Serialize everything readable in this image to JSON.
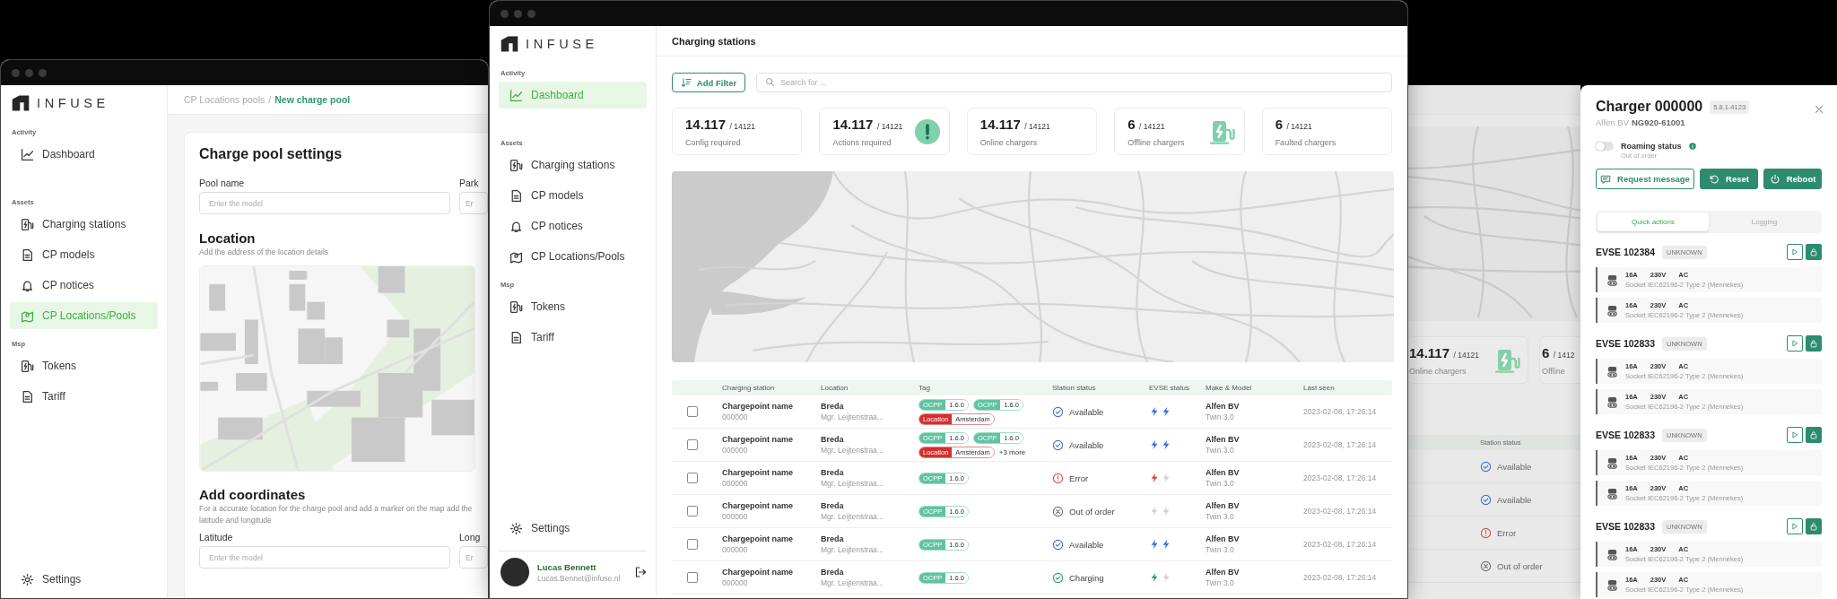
{
  "left_window": {
    "logo": "INFUSE",
    "sidebar": {
      "sections": [
        {
          "heading": "Activity",
          "items": [
            {
              "label": "Dashboard",
              "selected": false
            }
          ]
        },
        {
          "heading": "Assets",
          "items": [
            {
              "label": "Charging stations",
              "selected": false
            },
            {
              "label": "CP models",
              "selected": false
            },
            {
              "label": "CP notices",
              "selected": false
            },
            {
              "label": "CP Locations/Pools",
              "selected": true
            }
          ]
        },
        {
          "heading": "Msp",
          "items": [
            {
              "label": "Tokens",
              "selected": false
            },
            {
              "label": "Tariff",
              "selected": false
            }
          ]
        }
      ],
      "settings": "Settings"
    },
    "breadcrumb": {
      "items": [
        {
          "label": "CP Locations pools",
          "selected": false
        },
        {
          "label": "New charge pool",
          "selected": true
        }
      ],
      "separator": "/"
    },
    "form": {
      "title": "Charge pool settings",
      "name_fields": [
        {
          "label": "Pool name",
          "placeholder": "Enter the model"
        },
        {
          "label": "Park",
          "placeholder": "Er"
        }
      ],
      "location": {
        "title": "Location",
        "subtitle": "Add the address of the location details"
      },
      "coordinates": {
        "title": "Add coordinates",
        "subtitle": "For a accurate location for the charge pool and add a marker on the map add the latitude and longitude",
        "fields": [
          {
            "label": "Latitude",
            "placeholder": "Enter the model"
          },
          {
            "label": "Long",
            "placeholder": "Er"
          }
        ]
      }
    }
  },
  "center_window": {
    "logo": "INFUSE",
    "sidebar": {
      "sections": [
        {
          "heading": "Activity",
          "items": [
            {
              "label": "Dashboard",
              "selected": true
            }
          ]
        },
        {
          "heading": "Assets",
          "items": [
            {
              "label": "Charging stations",
              "selected": false
            },
            {
              "label": "CP models",
              "selected": false
            },
            {
              "label": "CP notices",
              "selected": false
            },
            {
              "label": "CP Locations/Pools",
              "selected": false
            }
          ]
        },
        {
          "heading": "Msp",
          "items": [
            {
              "label": "Tokens",
              "selected": false
            },
            {
              "label": "Tariff",
              "selected": false
            }
          ]
        }
      ],
      "settings": "Settings"
    },
    "user": {
      "name": "Lucas Bennett",
      "email": "Lucas.Bennet@infuse.nl"
    },
    "title": "Charging stations",
    "filter_button": "Add Filter",
    "search": {
      "placeholder": "Search for ..."
    },
    "stats": [
      {
        "value": "14.117",
        "total": "/ 14121",
        "label": "Config required"
      },
      {
        "value": "14.117",
        "total": "/ 14121",
        "label": "Actions required"
      },
      {
        "value": "14.117",
        "total": "/ 14121",
        "label": "Online chargers"
      },
      {
        "value": "6",
        "total": "/ 14121",
        "label": "Offline chargers"
      },
      {
        "value": "6",
        "total": "/ 14121",
        "label": "Faulted chargers"
      }
    ],
    "table": {
      "columns": [
        "Charging station",
        "Location",
        "Tag",
        "Station status",
        "EVSE status",
        "Make & Model",
        "Last seen"
      ],
      "rows": [
        {
          "checked": false,
          "name": "Chargepoint name",
          "id": "000000",
          "city": "Breda",
          "street": "Mgr. Leijtenstraa...",
          "tags": [
            {
              "kind": "ocpp",
              "key": "OCPP",
              "value": "1.6.0"
            },
            {
              "kind": "ocpp",
              "key": "OCPP",
              "value": "1.6.0"
            },
            {
              "kind": "location",
              "key": "Location",
              "value": "Amsterdam"
            }
          ],
          "status": {
            "kind": "available",
            "label": "Available"
          },
          "evse": [
            {
              "kind": "available"
            },
            {
              "kind": "available"
            }
          ],
          "make": "Alfen BV",
          "model": "Twin 3.0",
          "last_seen": "2023-02-08, 17:26:14"
        },
        {
          "checked": false,
          "name": "Chargepoint name",
          "id": "000000",
          "city": "Breda",
          "street": "Mgr. Leijtenstraa...",
          "tags": [
            {
              "kind": "ocpp",
              "key": "OCPP",
              "value": "1.6.0"
            },
            {
              "kind": "ocpp",
              "key": "OCPP",
              "value": "1.6.0"
            },
            {
              "kind": "location",
              "key": "Location",
              "value": "Amsterdam"
            }
          ],
          "more": "+3 more",
          "status": {
            "kind": "available",
            "label": "Available"
          },
          "evse": [
            {
              "kind": "available"
            },
            {
              "kind": "available"
            }
          ],
          "make": "Alfen BV",
          "model": "Twin 3.0",
          "last_seen": "2023-02-08, 17:26:14"
        },
        {
          "checked": false,
          "name": "Chargepoint name",
          "id": "000000",
          "city": "Breda",
          "street": "Mgr. Leijtenstraa...",
          "tags": [
            {
              "kind": "ocpp",
              "key": "OCPP",
              "value": "1.6.0"
            }
          ],
          "status": {
            "kind": "error",
            "label": "Error"
          },
          "evse": [
            {
              "kind": "fault"
            },
            {
              "kind": "off"
            }
          ],
          "make": "Alfen BV",
          "model": "Twin 3.0",
          "last_seen": "2023-02-08, 17:26:14"
        },
        {
          "checked": false,
          "name": "Chargepoint name",
          "id": "000000",
          "city": "Breda",
          "street": "Mgr. Leijtenstraa...",
          "tags": [
            {
              "kind": "ocpp",
              "key": "OCPP",
              "value": "1.6.0"
            }
          ],
          "status": {
            "kind": "out_of_order",
            "label": "Out of order"
          },
          "evse": [
            {
              "kind": "off"
            },
            {
              "kind": "off"
            }
          ],
          "make": "Alfen BV",
          "model": "Twin 3.0",
          "last_seen": "2023-02-08, 17:26:14"
        },
        {
          "checked": false,
          "name": "Chargepoint name",
          "id": "000000",
          "city": "Breda",
          "street": "Mgr. Leijtenstraa...",
          "tags": [
            {
              "kind": "ocpp",
              "key": "OCPP",
              "value": "1.6.0"
            }
          ],
          "status": {
            "kind": "available",
            "label": "Available"
          },
          "evse": [
            {
              "kind": "available"
            },
            {
              "kind": "available"
            }
          ],
          "make": "Alfen BV",
          "model": "Twin 3.0",
          "last_seen": "2023-02-08, 17:26:14"
        },
        {
          "checked": false,
          "name": "Chargepoint name",
          "id": "000000",
          "city": "Breda",
          "street": "Mgr. Leijtenstraa...",
          "tags": [
            {
              "kind": "ocpp",
              "key": "OCPP",
              "value": "1.6.0"
            }
          ],
          "status": {
            "kind": "charging",
            "label": "Charging"
          },
          "evse": [
            {
              "kind": "charging"
            },
            {
              "kind": "off"
            }
          ],
          "make": "Alfen BV",
          "model": "Twin 3.0",
          "last_seen": "2023-02-08, 17:26:14"
        }
      ]
    }
  },
  "background_window": {
    "stats": [
      {
        "value": "14.117",
        "total": "/ 14121",
        "label": "Online chargers"
      },
      {
        "value": "6",
        "total": "/ 1412",
        "label": "Offline"
      }
    ],
    "table": {
      "column": "Station status",
      "rows": [
        {
          "kind": "available",
          "label": "Available"
        },
        {
          "kind": "available",
          "label": "Available"
        },
        {
          "kind": "error",
          "label": "Error"
        },
        {
          "kind": "out_of_order",
          "label": "Out of order"
        }
      ]
    }
  },
  "charger_panel": {
    "title": "Charger 000000",
    "version": "5.8.1-4123",
    "vendor": "Alfen BV",
    "serial": "NG920-61001",
    "roaming": {
      "label": "Roaming status",
      "on": false,
      "note": "Out of order"
    },
    "buttons": [
      {
        "kind": "outline",
        "label": "Request message"
      },
      {
        "kind": "filled",
        "label": "Reset"
      },
      {
        "kind": "filled",
        "label": "Reboot"
      }
    ],
    "tabs": [
      {
        "label": "Quick actions",
        "selected": true
      },
      {
        "label": "Logging",
        "selected": false
      }
    ],
    "evses": [
      {
        "name": "EVSE 102384",
        "status": "UNKNOWN",
        "connectors": [
          {
            "current": "16A",
            "voltage": "230V",
            "type": "AC",
            "socket": "Socket IEC62196-2 Type 2 (Mennekes)"
          },
          {
            "current": "16A",
            "voltage": "230V",
            "type": "AC",
            "socket": "Socket IEC62196-2 Type 2 (Mennekes)"
          }
        ]
      },
      {
        "name": "EVSE 102833",
        "status": "UNKNOWN",
        "connectors": [
          {
            "current": "16A",
            "voltage": "230V",
            "type": "AC",
            "socket": "Socket IEC62196-2 Type 2 (Mennekes)"
          },
          {
            "current": "16A",
            "voltage": "230V",
            "type": "AC",
            "socket": "Socket IEC62196-2 Type 2 (Mennekes)"
          }
        ]
      },
      {
        "name": "EVSE 102833",
        "status": "UNKNOWN",
        "connectors": [
          {
            "current": "16A",
            "voltage": "230V",
            "type": "AC",
            "socket": "Socket IEC62196-2 Type 2 (Mennekes)"
          },
          {
            "current": "16A",
            "voltage": "230V",
            "type": "AC",
            "socket": "Socket IEC62196-2 Type 2 (Mennekes)"
          }
        ]
      },
      {
        "name": "EVSE 102833",
        "status": "UNKNOWN",
        "connectors": [
          {
            "current": "16A",
            "voltage": "230V",
            "type": "AC",
            "socket": "Socket IEC62196-2 Type 2 (Mennekes)"
          },
          {
            "current": "16A",
            "voltage": "230V",
            "type": "AC",
            "socket": "Socket IEC62196-2 Type 2 (Mennekes)"
          }
        ]
      }
    ]
  }
}
